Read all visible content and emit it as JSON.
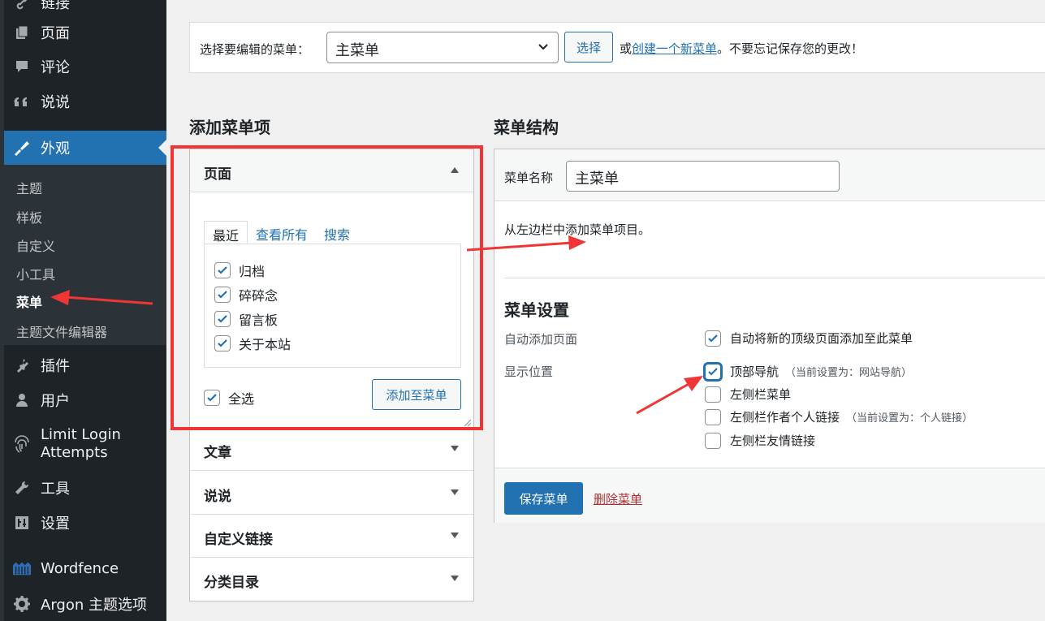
{
  "sidebar": {
    "items": [
      {
        "label": "链接",
        "icon": "link-icon"
      },
      {
        "label": "页面",
        "icon": "page-icon"
      },
      {
        "label": "评论",
        "icon": "comment-icon"
      },
      {
        "label": "说说",
        "icon": "quote-icon"
      },
      {
        "label": "外观",
        "icon": "paintbrush-icon"
      },
      {
        "label": "插件",
        "icon": "plugin-icon"
      },
      {
        "label": "用户",
        "icon": "user-icon"
      },
      {
        "label_line1": "Limit Login",
        "label_line2": "Attempts",
        "icon": "fingerprint-icon"
      },
      {
        "label": "工具",
        "icon": "wrench-icon"
      },
      {
        "label": "设置",
        "icon": "settings-icon"
      },
      {
        "label": "Wordfence",
        "icon": "wordfence-icon"
      },
      {
        "label": "Argon 主题选项",
        "icon": "gear-icon"
      }
    ],
    "submenu": [
      "主题",
      "样板",
      "自定义",
      "小工具",
      "菜单",
      "主题文件编辑器"
    ]
  },
  "select_bar": {
    "label": "选择要编辑的菜单：",
    "selected": "主菜单",
    "button": "选择",
    "hint_prefix": "或",
    "hint_link": "创建一个新菜单",
    "hint_suffix": "。不要忘记保存您的更改！"
  },
  "add_items": {
    "title": "添加菜单项",
    "sections": [
      "页面",
      "文章",
      "说说",
      "自定义链接",
      "分类目录"
    ],
    "tabs": [
      "最近",
      "查看所有",
      "搜索"
    ],
    "pages": [
      "归档",
      "碎碎念",
      "留言板",
      "关于本站"
    ],
    "select_all": "全选",
    "add_button": "添加至菜单"
  },
  "structure": {
    "title": "菜单结构",
    "name_label": "菜单名称",
    "name_value": "主菜单",
    "hint": "从左边栏中添加菜单项目。",
    "settings_title": "菜单设置",
    "auto_add_label": "自动添加页面",
    "auto_add_option": "自动将新的顶级页面添加至此菜单",
    "location_label": "显示位置",
    "locations": [
      {
        "label": "顶部导航",
        "note": "（当前设置为：网站导航）",
        "checked": true
      },
      {
        "label": "左侧栏菜单",
        "note": "",
        "checked": false
      },
      {
        "label": "左侧栏作者个人链接",
        "note": "（当前设置为：个人链接）",
        "checked": false
      },
      {
        "label": "左侧栏友情链接",
        "note": "",
        "checked": false
      }
    ],
    "save_button": "保存菜单",
    "delete_link": "删除菜单"
  },
  "colors": {
    "sidebar_bg": "#1d2327",
    "accent": "#2271b1",
    "annotation_red": "#ef3535",
    "danger": "#b32d2e"
  }
}
